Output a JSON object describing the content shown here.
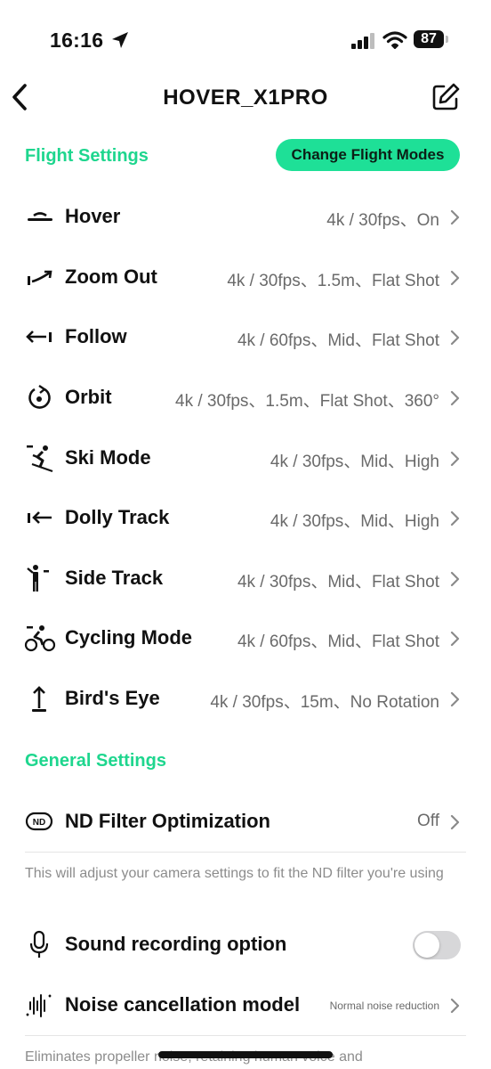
{
  "status_bar": {
    "time": "16:16",
    "battery": "87"
  },
  "header": {
    "title": "HOVER_X1PRO"
  },
  "flight_settings": {
    "title": "Flight Settings",
    "cta_label": "Change Flight Modes",
    "items": [
      {
        "icon": "hover-icon",
        "label": "Hover",
        "value": "4k / 30fps、On"
      },
      {
        "icon": "zoom-out-icon",
        "label": "Zoom Out",
        "value": "4k / 30fps、1.5m、Flat Shot"
      },
      {
        "icon": "follow-icon",
        "label": "Follow",
        "value": "4k / 60fps、Mid、Flat Shot"
      },
      {
        "icon": "orbit-icon",
        "label": "Orbit",
        "value": "4k / 30fps、1.5m、Flat Shot、360°"
      },
      {
        "icon": "ski-icon",
        "label": "Ski Mode",
        "value": "4k / 30fps、Mid、High"
      },
      {
        "icon": "dolly-track-icon",
        "label": "Dolly Track",
        "value": "4k / 30fps、Mid、High"
      },
      {
        "icon": "side-track-icon",
        "label": "Side Track",
        "value": "4k / 30fps、Mid、Flat Shot"
      },
      {
        "icon": "cycling-icon",
        "label": "Cycling Mode",
        "value": "4k / 60fps、Mid、Flat Shot"
      },
      {
        "icon": "birds-eye-icon",
        "label": "Bird's Eye",
        "value": "4k / 30fps、15m、No Rotation"
      }
    ]
  },
  "general_settings": {
    "title": "General Settings",
    "nd_filter": {
      "label": "ND Filter Optimization",
      "value": "Off",
      "note": "This will adjust your camera settings to fit the ND filter you're using"
    },
    "sound_recording": {
      "label": "Sound recording option",
      "enabled": false
    },
    "noise_cancellation": {
      "label": "Noise cancellation model",
      "value": "Normal noise reduction",
      "note": "Eliminates propeller noise, retaining human voice and"
    }
  },
  "colors": {
    "accent": "#1ed68e",
    "button": "#1ee097",
    "toggle_off": "#d7d7d9"
  }
}
